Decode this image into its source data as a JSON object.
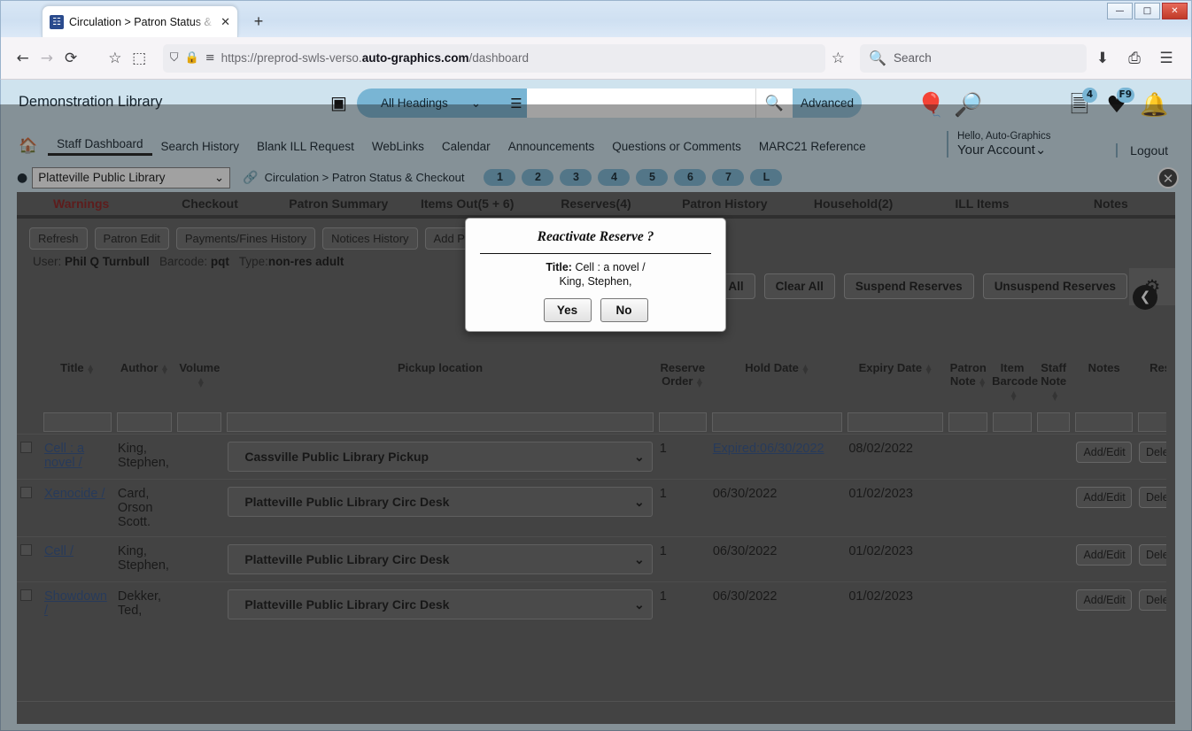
{
  "browser": {
    "tab": {
      "title": "Circulation > Patron Status & C",
      "favicon": "verso-icon",
      "close": "✕"
    },
    "newtab": "+",
    "window_controls": {
      "minimize": "—",
      "maximize": "□",
      "close": "✕"
    },
    "nav": {
      "back": "←",
      "forward": "→",
      "reload": "⟳",
      "bookmark": "☆",
      "pocket": "⬚",
      "shield": "⛉",
      "lock": "🔒",
      "perms": "≡"
    },
    "url_prefix": "https://preprod-swls-verso.",
    "url_domain": "auto-graphics.com",
    "url_suffix": "/dashboard",
    "search_placeholder": "Search",
    "right_icons": {
      "save_to_pocket": "⬇",
      "print": "⎙",
      "menu": "☰"
    }
  },
  "app": {
    "library_name": "Demonstration Library",
    "search": {
      "az_icon": "az-index-icon",
      "scope_selected": "All Headings",
      "scope_caret": "⌄",
      "database_icon": "database-icon",
      "query_value": "",
      "go_icon": "search-icon",
      "advanced_label": "Advanced"
    },
    "header_icons": [
      {
        "name": "balloon-icon",
        "glyph": "🎈",
        "badge": ""
      },
      {
        "name": "book-search-icon",
        "glyph": "🔎",
        "badge": ""
      },
      {
        "name": "requests-list-icon",
        "glyph": "🗒",
        "badge": "4"
      },
      {
        "name": "favorites-heart-icon",
        "glyph": "♥",
        "badge": "F9"
      },
      {
        "name": "notifications-bell-icon",
        "glyph": "🔔",
        "badge": ""
      }
    ],
    "nav_items": [
      {
        "label": "Staff Dashboard",
        "active": true
      },
      {
        "label": "Search History",
        "active": false
      },
      {
        "label": "Blank ILL Request",
        "active": false
      },
      {
        "label": "WebLinks",
        "active": false
      },
      {
        "label": "Calendar",
        "active": false
      },
      {
        "label": "Announcements",
        "active": false
      },
      {
        "label": "Questions or Comments",
        "active": false
      },
      {
        "label": "MARC21 Reference",
        "active": false
      }
    ],
    "home_icon": "home-icon",
    "account": {
      "hello": "Hello, Auto-Graphics",
      "name": "Your Account",
      "caret": "⌄",
      "logout": "Logout"
    },
    "breadcrumb": {
      "location_icon": "location-pin-icon",
      "library_selected": "Platteville Public Library",
      "select_caret": "⌄",
      "link_icon": "link-icon",
      "path": "Circulation > Patron Status & Checkout",
      "pills": [
        "1",
        "2",
        "3",
        "4",
        "5",
        "6",
        "7",
        "L"
      ],
      "close_label": "✕"
    }
  },
  "panel": {
    "tabs": [
      {
        "label": "Warnings",
        "warning": true
      },
      {
        "label": "Checkout",
        "warning": false
      },
      {
        "label": "Patron Summary",
        "warning": false
      },
      {
        "label": "Items Out(5 + 6)",
        "warning": false
      },
      {
        "label": "Reserves(4)",
        "warning": false
      },
      {
        "label": "Patron History",
        "warning": false
      },
      {
        "label": "Household(2)",
        "warning": false
      },
      {
        "label": "ILL Items",
        "warning": false
      },
      {
        "label": "Notes",
        "warning": false
      }
    ],
    "toolbar": [
      "Refresh",
      "Patron Edit",
      "Payments/Fines History",
      "Notices History",
      "Add Patron"
    ],
    "patron": {
      "user_label": "User:",
      "user_value": "Phil Q Turnbull",
      "barcode_label": "Barcode:",
      "barcode_value": "pqt",
      "type_label": "Type:",
      "type_value": "non-res adult"
    },
    "reserve_buttons": [
      "Select All",
      "Clear All",
      "Suspend Reserves",
      "Unsuspend Reserves"
    ],
    "gear_icon": "settings-gear-icon",
    "collapse_icon": "collapse-left-arrow-icon",
    "columns": [
      {
        "label": "",
        "sortable": false
      },
      {
        "label": "Title",
        "sortable": true
      },
      {
        "label": "Author",
        "sortable": true
      },
      {
        "label": "Volume",
        "sortable": true
      },
      {
        "label": "Pickup location",
        "sortable": false
      },
      {
        "label": "Reserve Order",
        "sortable": true
      },
      {
        "label": "Hold Date",
        "sortable": true
      },
      {
        "label": "Expiry Date",
        "sortable": true
      },
      {
        "label": "Patron Note",
        "sortable": true
      },
      {
        "label": "Item Barcode",
        "sortable": true
      },
      {
        "label": "Staff Note",
        "sortable": true
      },
      {
        "label": "Notes",
        "sortable": false
      },
      {
        "label": "Reserve",
        "sortable": false
      }
    ],
    "rows": [
      {
        "checked": false,
        "title": "Cell : a novel /",
        "author": "King, Stephen,",
        "volume": "",
        "pickup": "Cassville Public Library Pickup",
        "reserve_order": "1",
        "hold_date": "Expired:06/30/2022",
        "hold_date_is_link": true,
        "expiry_date": "08/02/2022",
        "patron_note": "",
        "item_barcode": "",
        "staff_note": "",
        "notes_btn": "Add/Edit",
        "reserve_btn": "Delete"
      },
      {
        "checked": false,
        "title": "Xenocide /",
        "author": "Card, Orson Scott.",
        "volume": "",
        "pickup": "Platteville Public Library Circ Desk",
        "reserve_order": "1",
        "hold_date": "06/30/2022",
        "hold_date_is_link": false,
        "expiry_date": "01/02/2023",
        "patron_note": "",
        "item_barcode": "",
        "staff_note": "",
        "notes_btn": "Add/Edit",
        "reserve_btn": "Delete"
      },
      {
        "checked": false,
        "title": "Cell /",
        "author": "King, Stephen,",
        "volume": "",
        "pickup": "Platteville Public Library Circ Desk",
        "reserve_order": "1",
        "hold_date": "06/30/2022",
        "hold_date_is_link": false,
        "expiry_date": "01/02/2023",
        "patron_note": "",
        "item_barcode": "",
        "staff_note": "",
        "notes_btn": "Add/Edit",
        "reserve_btn": "Delete"
      },
      {
        "checked": false,
        "title": "Showdown /",
        "author": "Dekker, Ted,",
        "volume": "",
        "pickup": "Platteville Public Library Circ Desk",
        "reserve_order": "1",
        "hold_date": "06/30/2022",
        "hold_date_is_link": false,
        "expiry_date": "01/02/2023",
        "patron_note": "",
        "item_barcode": "",
        "staff_note": "",
        "notes_btn": "Add/Edit",
        "reserve_btn": "Delete"
      }
    ]
  },
  "modal": {
    "title": "Reactivate Reserve ?",
    "label": "Title:",
    "value_line1": "Cell : a novel /",
    "value_line2": "King, Stephen,",
    "yes": "Yes",
    "no": "No"
  },
  "colors": {
    "app_header_bg": "#cfe3ee",
    "accent": "#79b5d4",
    "panel_bg": "#5e5e5e",
    "warning_text": "#8b1a1a",
    "link": "#2d4f86"
  }
}
